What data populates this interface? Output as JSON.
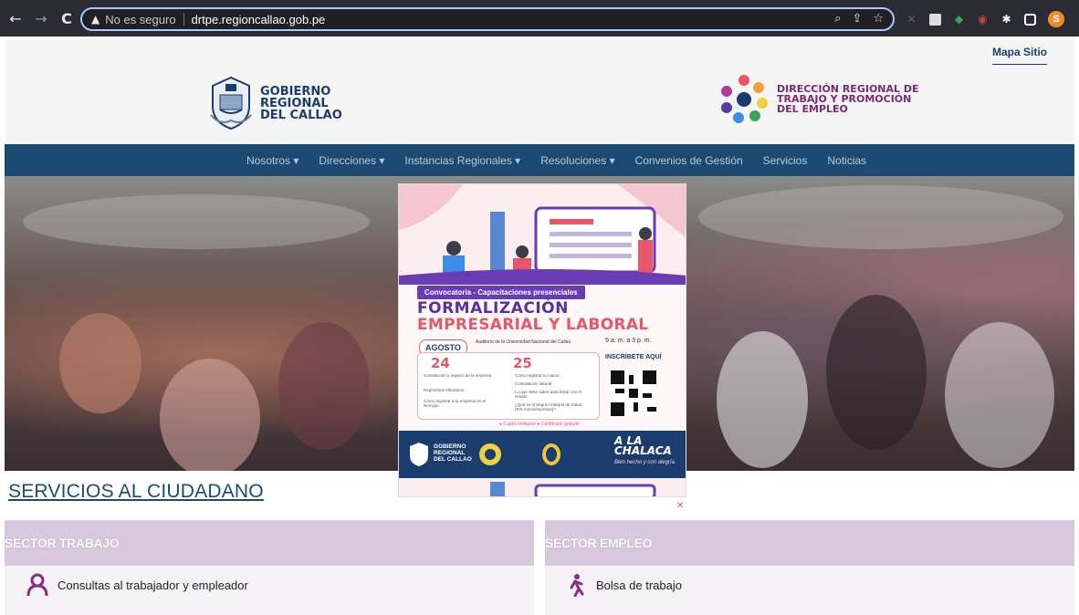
{
  "browser": {
    "back_icon": "back-arrow-icon",
    "forward_icon": "forward-arrow-icon",
    "reload_icon": "reload-icon",
    "security_label": "No es seguro",
    "url": "drtpe.regioncallao.gob.pe",
    "profile_initial": "S"
  },
  "header": {
    "site_map": "Mapa Sitio",
    "gob_logo": [
      "GOBIERNO",
      "REGIONAL",
      "DEL CALLAO"
    ],
    "drt_logo": [
      "DIRECCIÓN REGIONAL DE",
      "TRABAJO Y PROMOCIÓN",
      "DEL EMPLEO"
    ]
  },
  "nav": [
    "Nosotros ▾",
    "Direcciones ▾",
    "Instancias Regionales ▾",
    "Resoluciones ▾",
    "Convenios de Gestión",
    "Servicios",
    "Noticias"
  ],
  "flyer": {
    "banner": "Convocatoria - Capacitaciones presenciales",
    "title_line1": "FORMALIZACIÓN",
    "title_line2": "EMPRESARIAL Y LABORAL",
    "month": "AGOSTO",
    "venue": "Auditorio de la Universidad Nacional del Callao",
    "time": "9 a. m. a 3 p. m.",
    "day1": "24",
    "day1_items": [
      "Constitución y registro de la empresa",
      "Regímenes tributarios",
      "Cómo registrar a tu empresa en el Remype"
    ],
    "day2": "25",
    "day2_items": [
      "Cómo registrar tu marca",
      "Contratación laboral",
      "Lo que debe saber para licitar con el estado",
      "¿Qué es el Seguro Integral de Salud (SIS microempresas)?"
    ],
    "register": "INSCRÍBETE AQUÍ",
    "tags": "● Cupos limitados  ● Certificado gratuito",
    "footer_gob": [
      "GOBIERNO",
      "REGIONAL",
      "DEL CALLAO"
    ],
    "chalaca": [
      "A LA",
      "CHALACA"
    ],
    "tagline": "Bien hecho y con alegría"
  },
  "services": {
    "title": "SERVICIOS AL CIUDADANO",
    "sector_trabajo": {
      "title": "SECTOR TRABAJO",
      "item": "Consultas al trabajador y empleador"
    },
    "sector_empleo": {
      "title": "SECTOR EMPLEO",
      "item": "Bolsa de trabajo"
    }
  },
  "colors": {
    "chrome": "#2b2b33",
    "navbar": "#1c4a72",
    "accent_purple": "#6a3cb4",
    "accent_pink": "#e8566a",
    "panel_head": "#d7c8dd"
  }
}
